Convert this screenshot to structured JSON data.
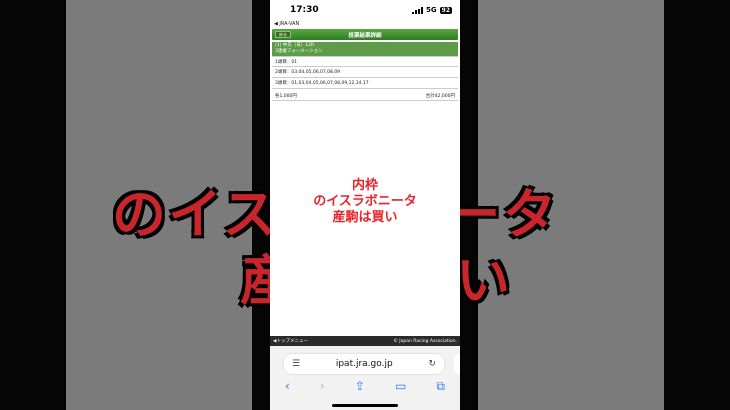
{
  "status_bar": {
    "time": "17:30",
    "network": "5G",
    "battery": "92"
  },
  "back_app": "◀ JRA-VAN",
  "header": {
    "back_label": "戻る",
    "title": "投票結果詳細"
  },
  "race": {
    "line1": "(1) 中京（日）12R",
    "line2": "3連複フォーメーション"
  },
  "selections": [
    {
      "label": "1頭目：",
      "value": "01"
    },
    {
      "label": "2頭目：",
      "value": "03,04,05,06,07,08,09"
    },
    {
      "label": "3頭目：",
      "value": "01,03,04,05,06,07,08,09,12,14,17"
    }
  ],
  "totals": {
    "each": "各1,000円",
    "total": "合計42,000円"
  },
  "overlay": {
    "line1": "内枠",
    "line2": "のイスラボニータ",
    "line3": "産駒は買い"
  },
  "background_text": {
    "line1": "のイスラボニータ",
    "line2": "産駒は買い"
  },
  "footer": {
    "top_menu": "◀トップメニュー",
    "copyright": "© Japan Racing Association."
  },
  "browser": {
    "url": "ipat.jra.go.jp"
  },
  "colors": {
    "header_green": "#3f8f2e",
    "overlay_red": "#e8232b",
    "link_blue": "#2f7af5"
  }
}
